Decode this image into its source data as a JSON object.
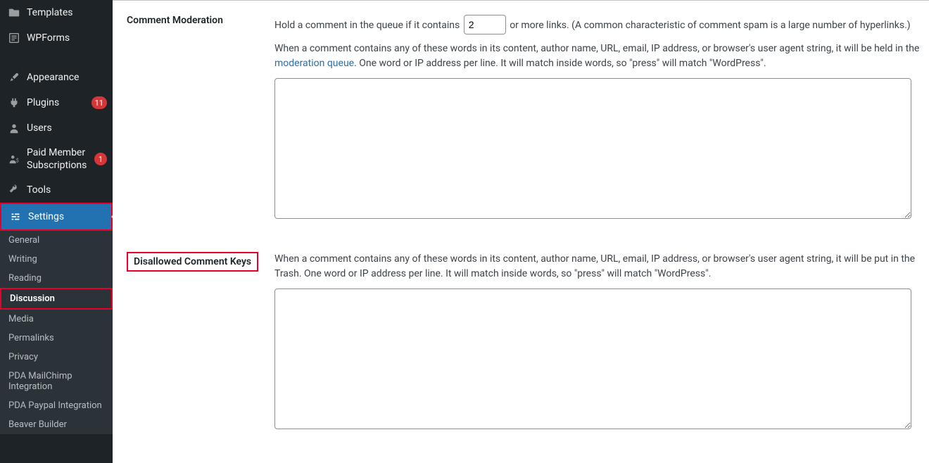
{
  "sidebar": {
    "templates": "Templates",
    "wpforms": "WPForms",
    "appearance": "Appearance",
    "plugins": "Plugins",
    "plugins_badge": "11",
    "users": "Users",
    "paid_member": "Paid Member Subscriptions",
    "paid_member_badge": "1",
    "tools": "Tools",
    "settings": "Settings",
    "submenu": {
      "general": "General",
      "writing": "Writing",
      "reading": "Reading",
      "discussion": "Discussion",
      "media": "Media",
      "permalinks": "Permalinks",
      "privacy": "Privacy",
      "pda_mailchimp": "PDA MailChimp Integration",
      "pda_paypal": "PDA Paypal Integration",
      "beaver": "Beaver Builder"
    }
  },
  "content": {
    "moderation_heading": "Comment Moderation",
    "moderation_pre": "Hold a comment in the queue if it contains",
    "moderation_value": "2",
    "moderation_post": "or more links. (A common characteristic of comment spam is a large number of hyperlinks.)",
    "moderation_desc_pre": "When a comment contains any of these words in its content, author name, URL, email, IP address, or browser's user agent string, it will be held in the ",
    "moderation_link": "moderation queue",
    "moderation_desc_post": ". One word or IP address per line. It will match inside words, so \"press\" will match \"WordPress\".",
    "disallowed_heading": "Disallowed Comment Keys",
    "disallowed_desc": "When a comment contains any of these words in its content, author name, URL, email, IP address, or browser's user agent string, it will be put in the Trash. One word or IP address per line. It will match inside words, so \"press\" will match \"WordPress\"."
  }
}
